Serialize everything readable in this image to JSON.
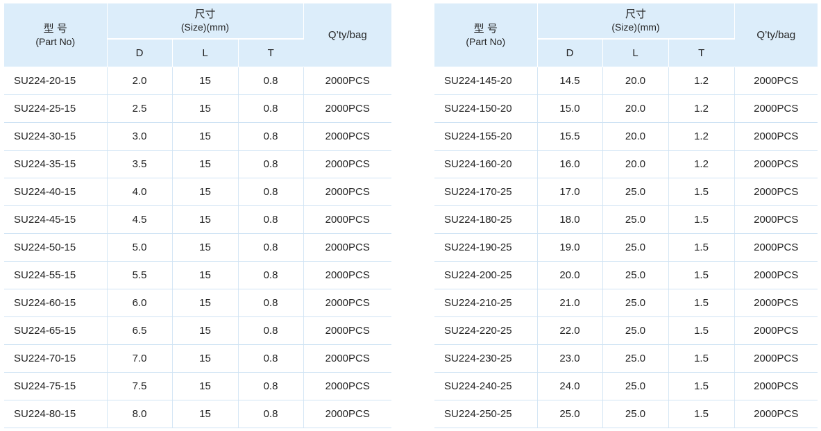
{
  "header": {
    "model_zh": "型  号",
    "model_en": "(Part No)",
    "size_zh": "尺寸",
    "size_en": "(Size)(mm)",
    "col_d": "D",
    "col_l": "L",
    "col_t": "T",
    "qty": "Q’ty/bag"
  },
  "left_rows": [
    {
      "part": "SU224-20-15",
      "d": "2.0",
      "l": "15",
      "t": "0.8",
      "qty": "2000PCS"
    },
    {
      "part": "SU224-25-15",
      "d": "2.5",
      "l": "15",
      "t": "0.8",
      "qty": "2000PCS"
    },
    {
      "part": "SU224-30-15",
      "d": "3.0",
      "l": "15",
      "t": "0.8",
      "qty": "2000PCS"
    },
    {
      "part": "SU224-35-15",
      "d": "3.5",
      "l": "15",
      "t": "0.8",
      "qty": "2000PCS"
    },
    {
      "part": "SU224-40-15",
      "d": "4.0",
      "l": "15",
      "t": "0.8",
      "qty": "2000PCS"
    },
    {
      "part": "SU224-45-15",
      "d": "4.5",
      "l": "15",
      "t": "0.8",
      "qty": "2000PCS"
    },
    {
      "part": "SU224-50-15",
      "d": "5.0",
      "l": "15",
      "t": "0.8",
      "qty": "2000PCS"
    },
    {
      "part": "SU224-55-15",
      "d": "5.5",
      "l": "15",
      "t": "0.8",
      "qty": "2000PCS"
    },
    {
      "part": "SU224-60-15",
      "d": "6.0",
      "l": "15",
      "t": "0.8",
      "qty": "2000PCS"
    },
    {
      "part": "SU224-65-15",
      "d": "6.5",
      "l": "15",
      "t": "0.8",
      "qty": "2000PCS"
    },
    {
      "part": "SU224-70-15",
      "d": "7.0",
      "l": "15",
      "t": "0.8",
      "qty": "2000PCS"
    },
    {
      "part": "SU224-75-15",
      "d": "7.5",
      "l": "15",
      "t": "0.8",
      "qty": "2000PCS"
    },
    {
      "part": "SU224-80-15",
      "d": "8.0",
      "l": "15",
      "t": "0.8",
      "qty": "2000PCS"
    }
  ],
  "right_rows": [
    {
      "part": "SU224-145-20",
      "d": "14.5",
      "l": "20.0",
      "t": "1.2",
      "qty": "2000PCS"
    },
    {
      "part": "SU224-150-20",
      "d": "15.0",
      "l": "20.0",
      "t": "1.2",
      "qty": "2000PCS"
    },
    {
      "part": "SU224-155-20",
      "d": "15.5",
      "l": "20.0",
      "t": "1.2",
      "qty": "2000PCS"
    },
    {
      "part": "SU224-160-20",
      "d": "16.0",
      "l": "20.0",
      "t": "1.2",
      "qty": "2000PCS"
    },
    {
      "part": "SU224-170-25",
      "d": "17.0",
      "l": "25.0",
      "t": "1.5",
      "qty": "2000PCS"
    },
    {
      "part": "SU224-180-25",
      "d": "18.0",
      "l": "25.0",
      "t": "1.5",
      "qty": "2000PCS"
    },
    {
      "part": "SU224-190-25",
      "d": "19.0",
      "l": "25.0",
      "t": "1.5",
      "qty": "2000PCS"
    },
    {
      "part": "SU224-200-25",
      "d": "20.0",
      "l": "25.0",
      "t": "1.5",
      "qty": "2000PCS"
    },
    {
      "part": "SU224-210-25",
      "d": "21.0",
      "l": "25.0",
      "t": "1.5",
      "qty": "2000PCS"
    },
    {
      "part": "SU224-220-25",
      "d": "22.0",
      "l": "25.0",
      "t": "1.5",
      "qty": "2000PCS"
    },
    {
      "part": "SU224-230-25",
      "d": "23.0",
      "l": "25.0",
      "t": "1.5",
      "qty": "2000PCS"
    },
    {
      "part": "SU224-240-25",
      "d": "24.0",
      "l": "25.0",
      "t": "1.5",
      "qty": "2000PCS"
    },
    {
      "part": "SU224-250-25",
      "d": "25.0",
      "l": "25.0",
      "t": "1.5",
      "qty": "2000PCS"
    }
  ]
}
